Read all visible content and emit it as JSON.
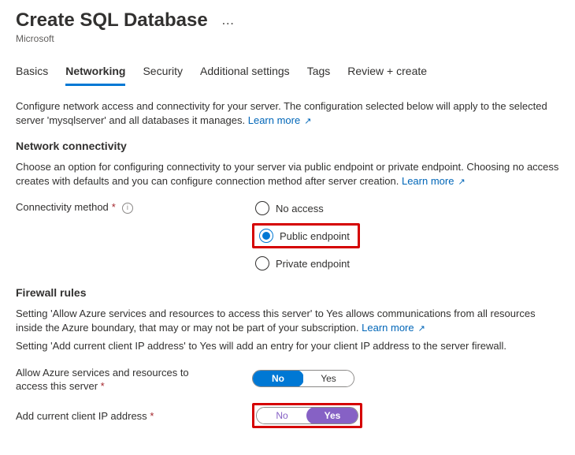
{
  "header": {
    "title": "Create SQL Database",
    "vendor": "Microsoft"
  },
  "tabs": [
    "Basics",
    "Networking",
    "Security",
    "Additional settings",
    "Tags",
    "Review + create"
  ],
  "active_tab": 1,
  "networking": {
    "intro": "Configure network access and connectivity for your server. The configuration selected below will apply to the selected server 'mysqlserver' and all databases it manages.",
    "learn_more": "Learn more",
    "connectivity": {
      "heading": "Network connectivity",
      "desc": "Choose an option for configuring connectivity to your server via public endpoint or private endpoint. Choosing no access creates with defaults and you can configure connection method after server creation.",
      "learn_more": "Learn more",
      "label": "Connectivity method",
      "required": "*",
      "options": [
        "No access",
        "Public endpoint",
        "Private endpoint"
      ],
      "selected_index": 1
    },
    "firewall": {
      "heading": "Firewall rules",
      "desc1": "Setting 'Allow Azure services and resources to access this server' to Yes allows communications from all resources inside the Azure boundary, that may or may not be part of your subscription.",
      "learn_more": "Learn more",
      "desc2": "Setting 'Add current client IP address' to Yes will add an entry for your client IP address to the server firewall.",
      "allow_azure": {
        "label": "Allow Azure services and resources to access this server",
        "required": "*",
        "value": "No",
        "no": "No",
        "yes": "Yes"
      },
      "add_ip": {
        "label": "Add current client IP address",
        "required": "*",
        "value": "Yes",
        "no": "No",
        "yes": "Yes"
      }
    }
  }
}
